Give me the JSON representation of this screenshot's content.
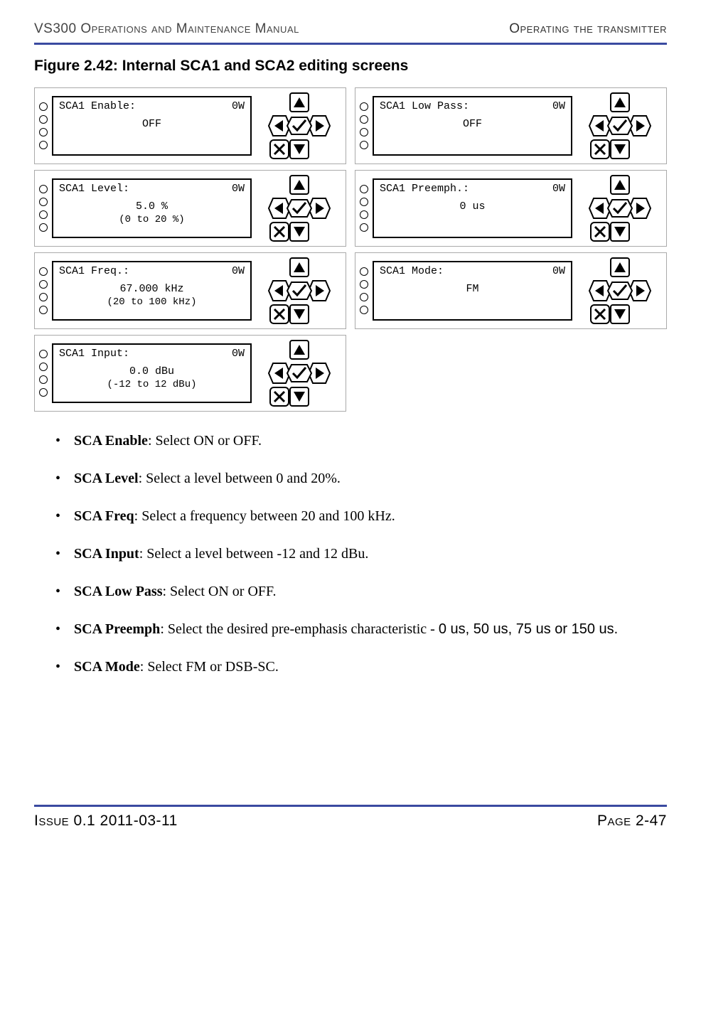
{
  "header": {
    "left": "VS300 Operations and Maintenance Manual",
    "right": "Operating the transmitter"
  },
  "figure": {
    "title": "Figure 2.42: Internal SCA1 and SCA2 editing screens"
  },
  "screens": [
    {
      "title": "SCA1 Enable:",
      "power": "0W",
      "value": "OFF",
      "range": ""
    },
    {
      "title": "SCA1 Low Pass:",
      "power": "0W",
      "value": "OFF",
      "range": ""
    },
    {
      "title": "SCA1 Level:",
      "power": "0W",
      "value": "5.0 %",
      "range": "(0 to 20 %)"
    },
    {
      "title": "SCA1 Preemph.:",
      "power": "0W",
      "value": "0 us",
      "range": ""
    },
    {
      "title": "SCA1 Freq.:",
      "power": "0W",
      "value": "67.000 kHz",
      "range": "(20 to 100 kHz)"
    },
    {
      "title": "SCA1 Mode:",
      "power": "0W",
      "value": "FM",
      "range": ""
    },
    {
      "title": "SCA1 Input:",
      "power": "0W",
      "value": "0.0 dBu",
      "range": "(-12 to 12 dBu)"
    }
  ],
  "bullets": [
    {
      "label": "SCA Enable",
      "text": ": Select ON or OFF."
    },
    {
      "label": "SCA Level",
      "text": ": Select a level between 0 and 20%."
    },
    {
      "label": "SCA Freq",
      "text": ": Select a frequency between 20 and 100 kHz."
    },
    {
      "label": "SCA Input",
      "text": ": Select a level between -12 and 12 dBu."
    },
    {
      "label": "SCA Low Pass",
      "text": ": Select ON or OFF."
    },
    {
      "label": "SCA Preemph",
      "text": ": Select the desired pre-emphasis characteristic - ",
      "opts": "0 us, 50 us, 75 us or 150 us."
    },
    {
      "label": "SCA Mode",
      "text": ": Select FM or DSB-SC."
    }
  ],
  "footer": {
    "left": "Issue 0.1  2011-03-11",
    "right": "Page 2-47"
  },
  "icons": {
    "up": "up-arrow",
    "down": "down-arrow",
    "left": "left-arrow",
    "right": "right-arrow",
    "ok": "check",
    "cancel": "x"
  }
}
